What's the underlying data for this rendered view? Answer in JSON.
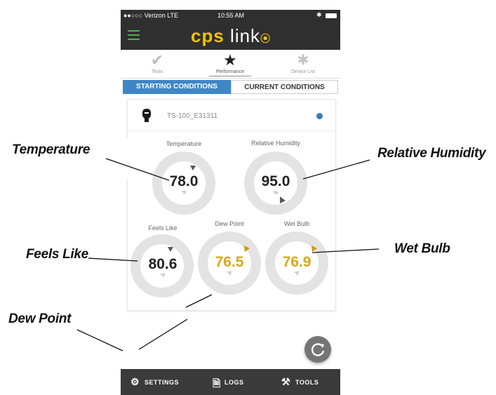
{
  "status_bar": {
    "carrier": "●●○○○ Verizon  LTE",
    "time": "10:55 AM"
  },
  "app": {
    "logo_cps": "cps",
    "logo_link": "link",
    "accent": "#f2c200"
  },
  "tabs": [
    {
      "label": "Tests",
      "icon": "check-icon"
    },
    {
      "label": "Performance",
      "icon": "star-icon"
    },
    {
      "label": "Device List",
      "icon": "bluetooth-icon"
    }
  ],
  "conditions": {
    "starting": "STARTING CONDITIONS",
    "current": "CURRENT CONDITIONS"
  },
  "device": {
    "name": "TS-100_E31311",
    "status_color": "#3b78c4"
  },
  "gauges": {
    "temperature": {
      "title": "Temperature",
      "value": "78.0",
      "unit": "°F",
      "level": 0.5
    },
    "humidity": {
      "title": "Relative Humidity",
      "value": "95.0",
      "unit": "%",
      "level": 0.95
    },
    "feels_like": {
      "title": "Feels Like",
      "value": "80.6",
      "unit": "°F",
      "level": 0.55
    },
    "dew_point": {
      "title": "Dew Point",
      "value": "76.5",
      "unit": "°F",
      "level": 0.7
    },
    "wet_bulb": {
      "title": "Wet Bulb",
      "value": "76.9",
      "unit": "°F",
      "level": 0.7
    }
  },
  "bottom_bar": {
    "settings": "SETTINGS",
    "logs": "LOGS",
    "tools": "TOOLS"
  },
  "callouts": {
    "temperature": "Temperature",
    "humidity": "Relative Humidity",
    "feels_like": "Feels Like",
    "wet_bulb": "Wet Bulb",
    "dew_point": "Dew Point"
  },
  "colors": {
    "gold": "#e0ad20",
    "navy": "#25287a",
    "track": "#e3e3e3",
    "blue_tab": "#3f86c7"
  }
}
